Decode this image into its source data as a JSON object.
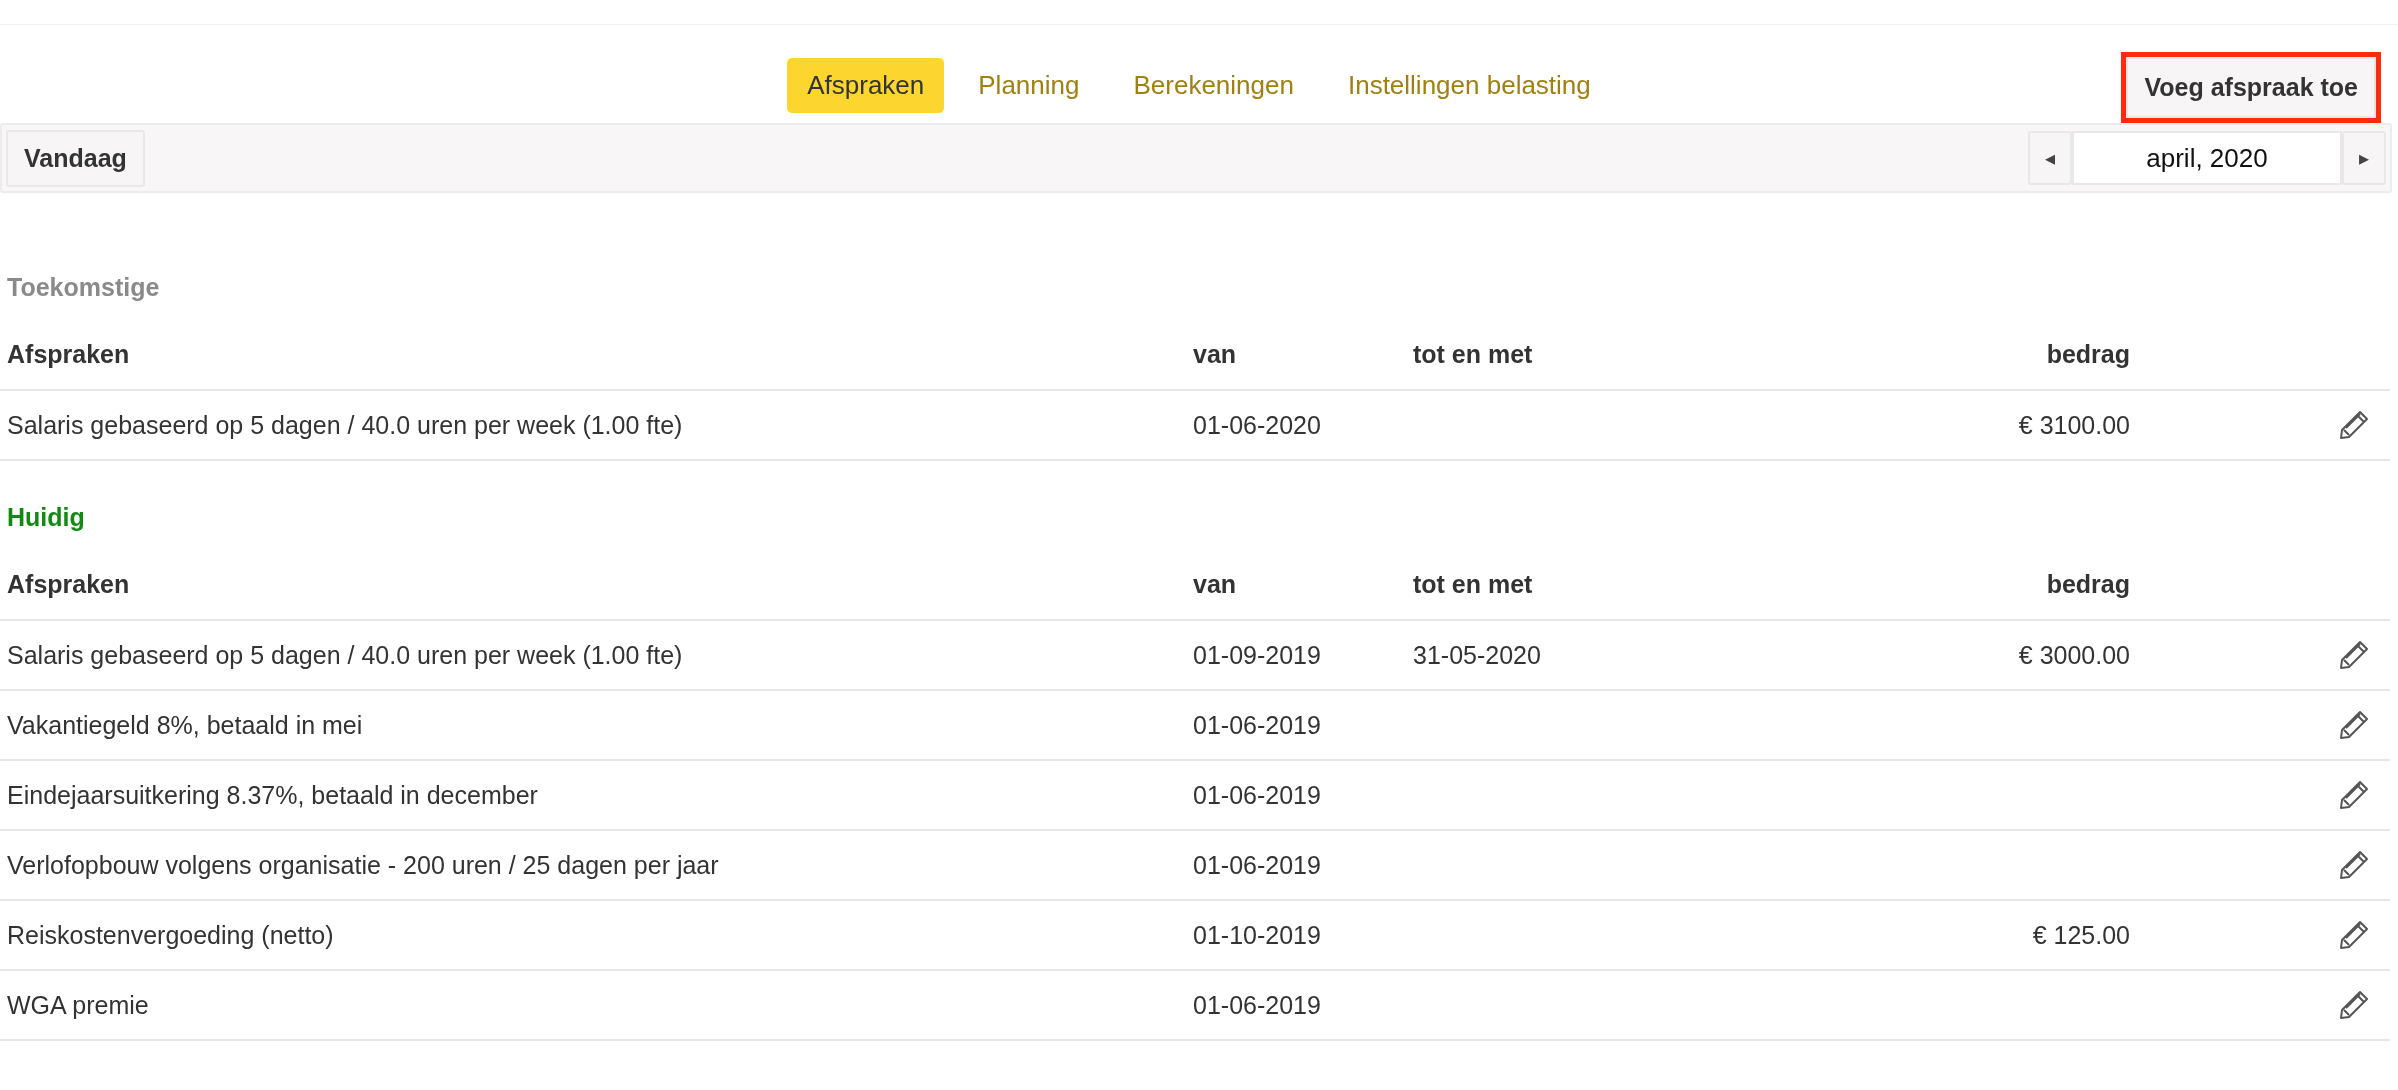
{
  "tabs": [
    {
      "label": "Afspraken",
      "selected": true
    },
    {
      "label": "Planning",
      "selected": false
    },
    {
      "label": "Berekeningen",
      "selected": false
    },
    {
      "label": "Instellingen belasting",
      "selected": false
    }
  ],
  "add_button": {
    "label": "Voeg afspraak toe",
    "highlighted": true
  },
  "toolbar": {
    "today_button": "Vandaag",
    "month": "april, 2020",
    "prev": "◂",
    "next": "▸"
  },
  "sections": [
    {
      "title": "Toekomstige",
      "kind": "future",
      "columns": [
        "Afspraken",
        "van",
        "tot en met",
        "bedrag"
      ],
      "rows": [
        {
          "name": "Salaris gebaseerd op 5 dagen / 40.0 uren per week (1.00 fte)",
          "from": "01-06-2020",
          "to": "",
          "amount": "€ 3100.00"
        }
      ]
    },
    {
      "title": "Huidig",
      "kind": "current",
      "columns": [
        "Afspraken",
        "van",
        "tot en met",
        "bedrag"
      ],
      "rows": [
        {
          "name": "Salaris gebaseerd op 5 dagen / 40.0 uren per week (1.00 fte)",
          "from": "01-09-2019",
          "to": "31-05-2020",
          "amount": "€ 3000.00"
        },
        {
          "name": "Vakantiegeld 8%, betaald in mei",
          "from": "01-06-2019",
          "to": "",
          "amount": ""
        },
        {
          "name": "Eindejaarsuitkering 8.37%, betaald in december",
          "from": "01-06-2019",
          "to": "",
          "amount": ""
        },
        {
          "name": "Verlofopbouw volgens organisatie - 200 uren / 25 dagen per jaar",
          "from": "01-06-2019",
          "to": "",
          "amount": ""
        },
        {
          "name": "Reiskostenvergoeding (netto)",
          "from": "01-10-2019",
          "to": "",
          "amount": "€ 125.00"
        },
        {
          "name": "WGA premie",
          "from": "01-06-2019",
          "to": "",
          "amount": ""
        }
      ]
    }
  ]
}
